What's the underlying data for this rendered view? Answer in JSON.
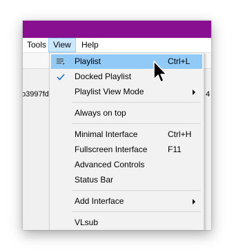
{
  "menubar": {
    "items": [
      {
        "label": "Tools"
      },
      {
        "label": "View"
      },
      {
        "label": "Help"
      }
    ]
  },
  "background": {
    "left_text": "b3997fd",
    "right_text": "4"
  },
  "view_menu": {
    "items": [
      {
        "label": "Playlist",
        "shortcut": "Ctrl+L",
        "icon": "playlist-icon",
        "highlighted": true
      },
      {
        "label": "Docked Playlist",
        "icon": "checkmark-icon",
        "checked": true
      },
      {
        "label": "Playlist View Mode",
        "submenu": true
      },
      {
        "label": "Always on top"
      },
      {
        "label": "Minimal Interface",
        "shortcut": "Ctrl+H"
      },
      {
        "label": "Fullscreen Interface",
        "shortcut": "F11"
      },
      {
        "label": "Advanced Controls"
      },
      {
        "label": "Status Bar"
      },
      {
        "label": "Add Interface",
        "submenu": true
      },
      {
        "label": "VLsub"
      }
    ]
  },
  "colors": {
    "title_bar": "#880f8f",
    "menu_highlight": "#91c9f7",
    "open_menu_title": "#cce8ff",
    "checkmark": "#1a6fc9"
  }
}
